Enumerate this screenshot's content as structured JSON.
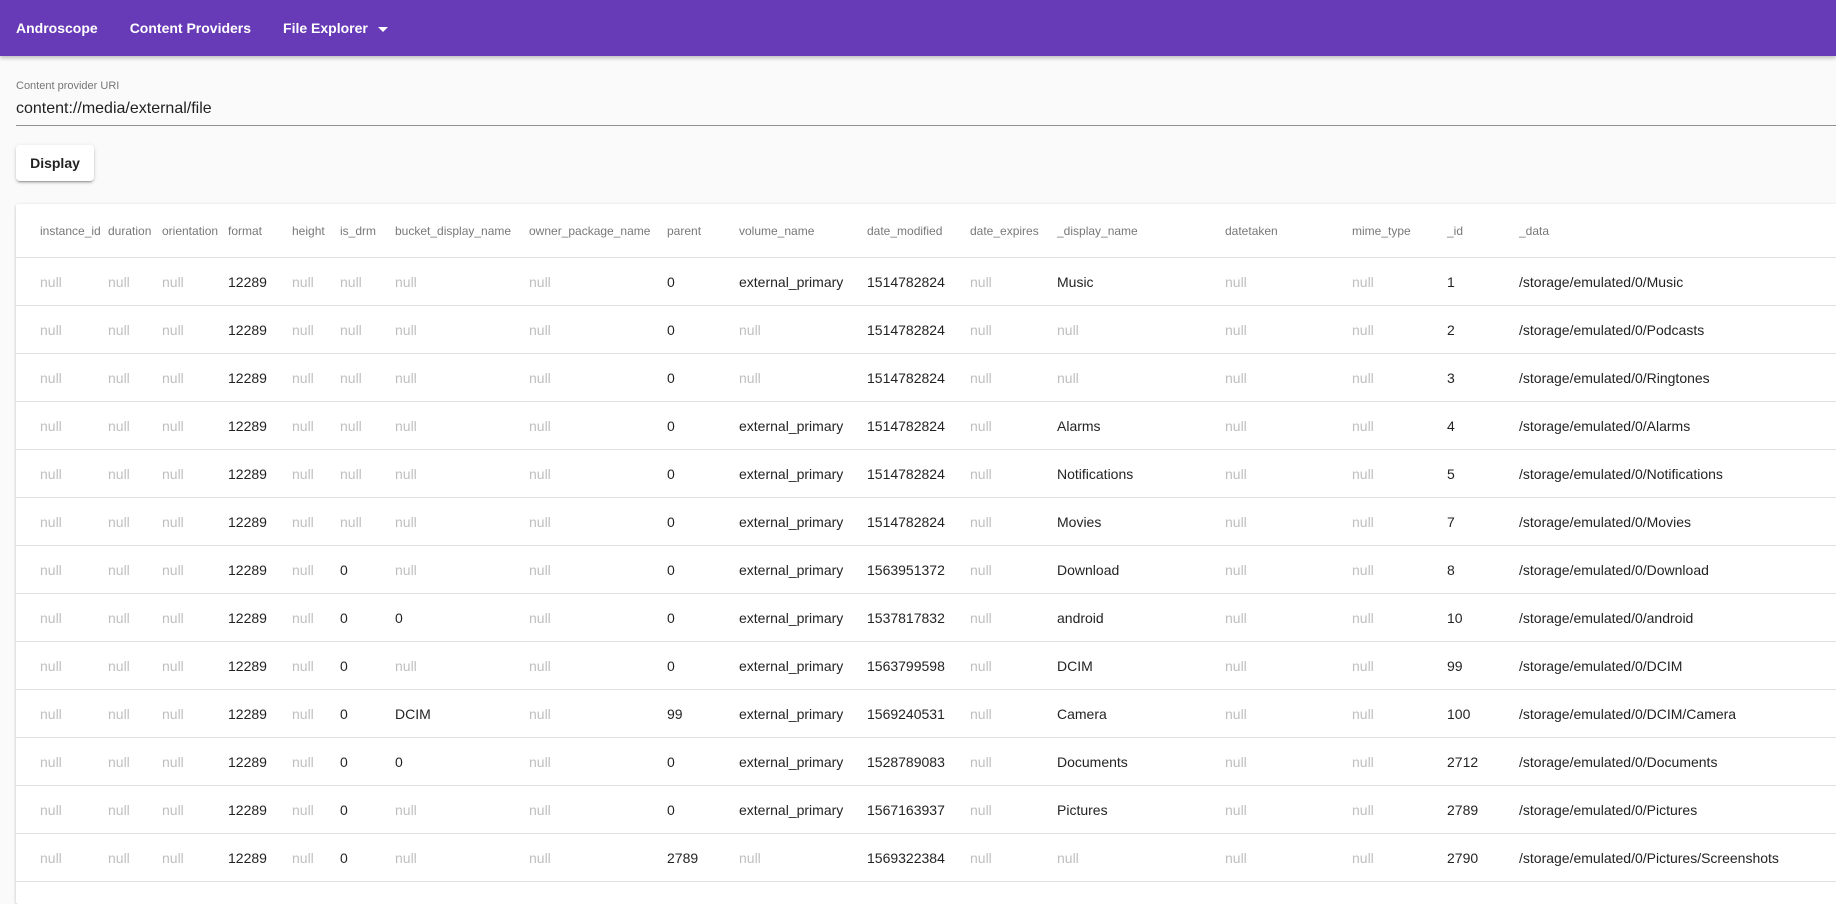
{
  "nav": {
    "brand": "Androscope",
    "content_providers": "Content Providers",
    "file_explorer": "File Explorer"
  },
  "uri": {
    "label": "Content provider URI",
    "value": "content://media/external/file"
  },
  "display_button": "Display",
  "table": {
    "columns": [
      "instance_id",
      "duration",
      "orientation",
      "format",
      "height",
      "is_drm",
      "bucket_display_name",
      "owner_package_name",
      "parent",
      "volume_name",
      "date_modified",
      "date_expires",
      "_display_name",
      "datetaken",
      "mime_type",
      "_id",
      "_data"
    ],
    "rows": [
      [
        "null",
        "null",
        "null",
        "12289",
        "null",
        "null",
        "null",
        "null",
        "0",
        "external_primary",
        "1514782824",
        "null",
        "Music",
        "null",
        "null",
        "1",
        "/storage/emulated/0/Music"
      ],
      [
        "null",
        "null",
        "null",
        "12289",
        "null",
        "null",
        "null",
        "null",
        "0",
        "null",
        "1514782824",
        "null",
        "null",
        "null",
        "null",
        "2",
        "/storage/emulated/0/Podcasts"
      ],
      [
        "null",
        "null",
        "null",
        "12289",
        "null",
        "null",
        "null",
        "null",
        "0",
        "null",
        "1514782824",
        "null",
        "null",
        "null",
        "null",
        "3",
        "/storage/emulated/0/Ringtones"
      ],
      [
        "null",
        "null",
        "null",
        "12289",
        "null",
        "null",
        "null",
        "null",
        "0",
        "external_primary",
        "1514782824",
        "null",
        "Alarms",
        "null",
        "null",
        "4",
        "/storage/emulated/0/Alarms"
      ],
      [
        "null",
        "null",
        "null",
        "12289",
        "null",
        "null",
        "null",
        "null",
        "0",
        "external_primary",
        "1514782824",
        "null",
        "Notifications",
        "null",
        "null",
        "5",
        "/storage/emulated/0/Notifications"
      ],
      [
        "null",
        "null",
        "null",
        "12289",
        "null",
        "null",
        "null",
        "null",
        "0",
        "external_primary",
        "1514782824",
        "null",
        "Movies",
        "null",
        "null",
        "7",
        "/storage/emulated/0/Movies"
      ],
      [
        "null",
        "null",
        "null",
        "12289",
        "null",
        "0",
        "null",
        "null",
        "0",
        "external_primary",
        "1563951372",
        "null",
        "Download",
        "null",
        "null",
        "8",
        "/storage/emulated/0/Download"
      ],
      [
        "null",
        "null",
        "null",
        "12289",
        "null",
        "0",
        "0",
        "null",
        "0",
        "external_primary",
        "1537817832",
        "null",
        "android",
        "null",
        "null",
        "10",
        "/storage/emulated/0/android"
      ],
      [
        "null",
        "null",
        "null",
        "12289",
        "null",
        "0",
        "null",
        "null",
        "0",
        "external_primary",
        "1563799598",
        "null",
        "DCIM",
        "null",
        "null",
        "99",
        "/storage/emulated/0/DCIM"
      ],
      [
        "null",
        "null",
        "null",
        "12289",
        "null",
        "0",
        "DCIM",
        "null",
        "99",
        "external_primary",
        "1569240531",
        "null",
        "Camera",
        "null",
        "null",
        "100",
        "/storage/emulated/0/DCIM/Camera"
      ],
      [
        "null",
        "null",
        "null",
        "12289",
        "null",
        "0",
        "0",
        "null",
        "0",
        "external_primary",
        "1528789083",
        "null",
        "Documents",
        "null",
        "null",
        "2712",
        "/storage/emulated/0/Documents"
      ],
      [
        "null",
        "null",
        "null",
        "12289",
        "null",
        "0",
        "null",
        "null",
        "0",
        "external_primary",
        "1567163937",
        "null",
        "Pictures",
        "null",
        "null",
        "2789",
        "/storage/emulated/0/Pictures"
      ],
      [
        "null",
        "null",
        "null",
        "12289",
        "null",
        "0",
        "null",
        "null",
        "2789",
        "null",
        "1569322384",
        "null",
        "null",
        "null",
        "null",
        "2790",
        "/storage/emulated/0/Pictures/Screenshots"
      ]
    ]
  },
  "colors": {
    "appbar": "#673ab7",
    "null_text": "rgba(0,0,0,0.26)"
  }
}
